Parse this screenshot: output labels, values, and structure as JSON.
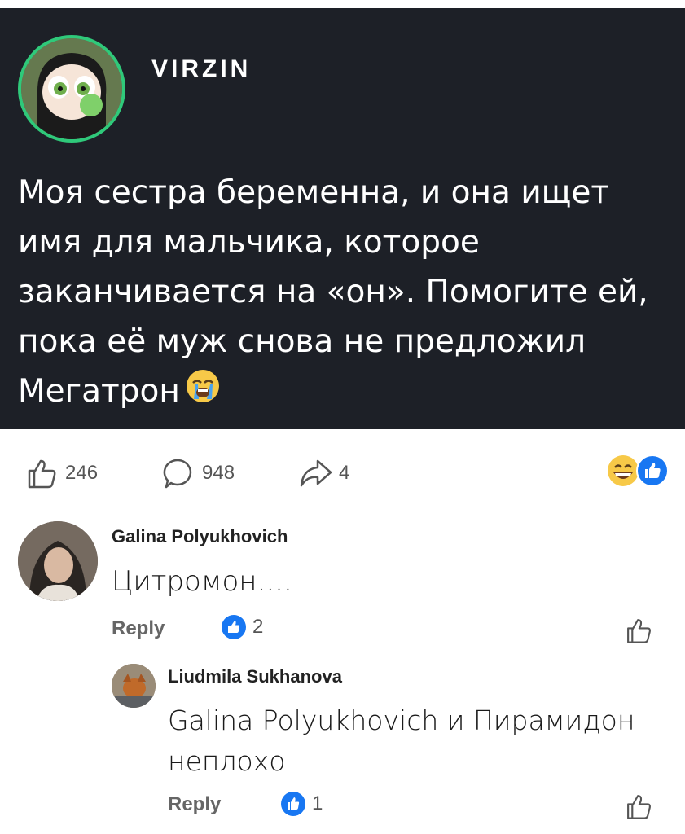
{
  "post": {
    "author": "VIRZIN",
    "text": "Моя сестра беременна, и она ищет имя для мальчика, которое заканчивается на «он». Помогите ей, пока её муж снова не предложил Мегатрон",
    "emoji": "crying-face"
  },
  "actions": {
    "likes": "246",
    "comments": "948",
    "shares": "4",
    "reactions": [
      "grinning-face",
      "like"
    ]
  },
  "comments": [
    {
      "name": "Galina Polyukhovich",
      "text": "Цитромон....",
      "reply_label": "Reply",
      "like_count": "2"
    },
    {
      "name": "Liudmila Sukhanova",
      "text": "Galina Polyukhovich и Пирамидон неплохо",
      "reply_label": "Reply",
      "like_count": "1"
    }
  ],
  "colors": {
    "post_bg": "#1d2027",
    "accent_blue": "#1877f2",
    "avatar_ring": "#2fc97a"
  }
}
